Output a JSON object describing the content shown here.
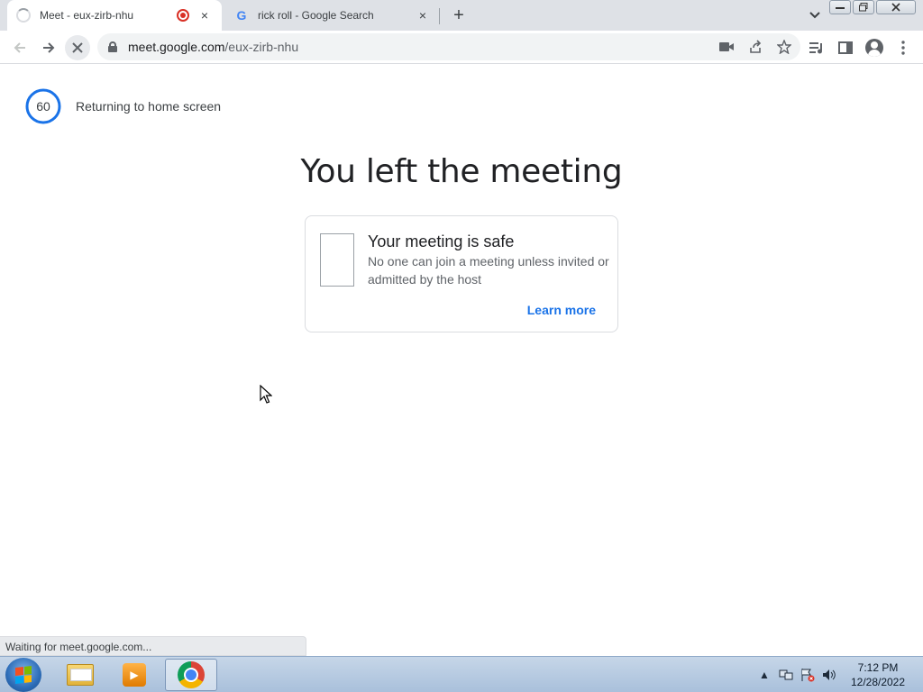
{
  "browser": {
    "tabs": [
      {
        "title": "Meet - eux-zirb-nhu",
        "active": true,
        "recording": true
      },
      {
        "title": "rick roll - Google Search",
        "active": false,
        "favicon": "G"
      }
    ],
    "new_tab_icon": "+",
    "close_icon": "×",
    "omnibox": {
      "host": "meet.google.com",
      "path": "/eux-zirb-nhu"
    },
    "window_controls": [
      "minimize",
      "restore",
      "close"
    ]
  },
  "page": {
    "countdown_value": "60",
    "returning_text": "Returning to home screen",
    "headline": "You left the meeting",
    "card": {
      "title": "Your meeting is safe",
      "body": "No one can join a meeting unless invited or admitted by the host",
      "link": "Learn more"
    },
    "status_text": "Waiting for meet.google.com..."
  },
  "taskbar": {
    "apps": [
      "windows-explorer",
      "media-player",
      "google-chrome"
    ],
    "clock_time": "7:12 PM",
    "clock_date": "12/28/2022"
  },
  "colors": {
    "accent": "#1a73e8",
    "tabstrip": "#dee1e6",
    "recording": "#d93025"
  }
}
